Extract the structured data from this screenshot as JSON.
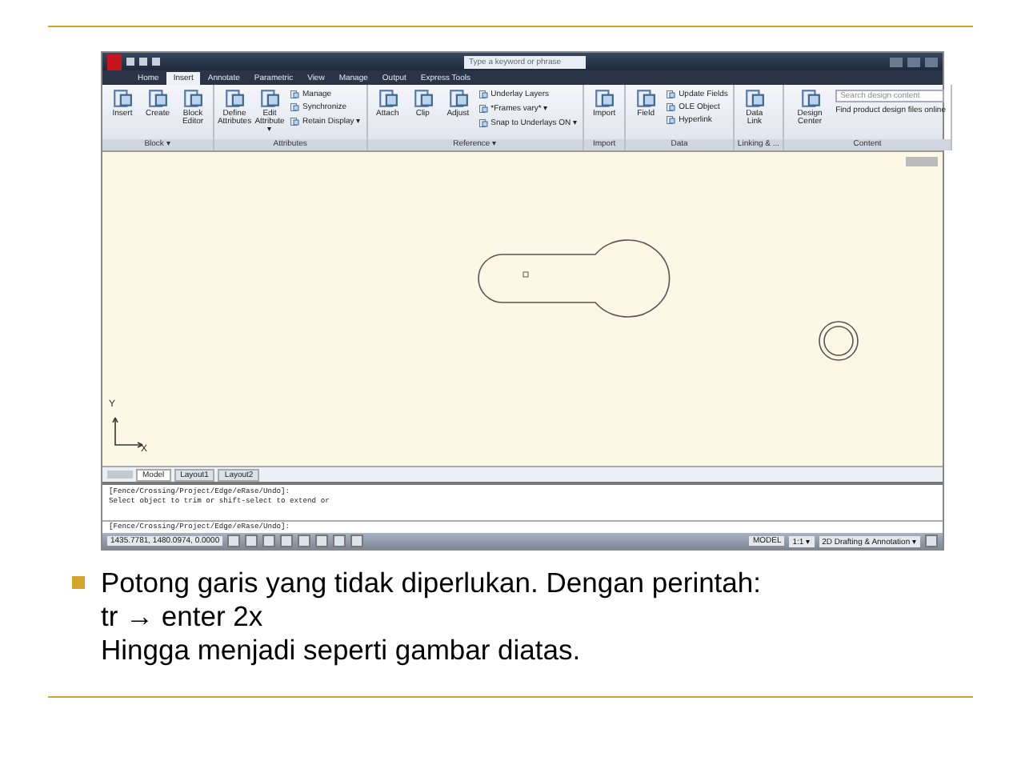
{
  "app": {
    "search_placeholder": "Type a keyword or phrase",
    "tabs": [
      {
        "label": "Home",
        "selected": false
      },
      {
        "label": "Insert",
        "selected": true
      },
      {
        "label": "Annotate",
        "selected": false
      },
      {
        "label": "Parametric",
        "selected": false
      },
      {
        "label": "View",
        "selected": false
      },
      {
        "label": "Manage",
        "selected": false
      },
      {
        "label": "Output",
        "selected": false
      },
      {
        "label": "Express Tools",
        "selected": false
      }
    ],
    "panels": [
      {
        "label": "Block ▾",
        "large": [
          "Insert",
          "Create",
          "Block Editor"
        ]
      },
      {
        "label": "Attributes",
        "large": [
          "Define Attributes",
          "Edit Attribute ▾"
        ],
        "small": [
          "Manage",
          "Synchronize",
          "Retain Display ▾"
        ]
      },
      {
        "label": "Reference ▾",
        "large": [
          "Attach",
          "Clip",
          "Adjust"
        ],
        "small": [
          "Underlay Layers",
          "*Frames vary* ▾",
          "Snap to Underlays ON ▾"
        ]
      },
      {
        "label": "Import",
        "large": [
          "Import"
        ]
      },
      {
        "label": "Data",
        "large": [
          "Field"
        ],
        "small": [
          "Update Fields",
          "OLE Object",
          "Hyperlink"
        ]
      },
      {
        "label": "Linking & ...",
        "large": [
          "Data Link"
        ]
      }
    ],
    "content_panel": {
      "label": "Content",
      "tool": "Design Center",
      "search_placeholder": "Search design content",
      "link": "Find product design files online"
    },
    "axis": {
      "y": "Y",
      "x": "X"
    },
    "layout_tabs": [
      {
        "label": "Model",
        "selected": true
      },
      {
        "label": "Layout1",
        "selected": false
      },
      {
        "label": "Layout2",
        "selected": false
      }
    ],
    "command_history": [
      "[Fence/Crossing/Project/Edge/eRase/Undo]:",
      "Select object to trim or shift-select to extend or"
    ],
    "command_line": "[Fence/Crossing/Project/Edge/eRase/Undo]:",
    "status": {
      "coordinates": "1435.7781, 1480.0974, 0.0000",
      "model": "MODEL",
      "scale": "1:1 ▾",
      "workspace": "2D Drafting & Annotation ▾"
    }
  },
  "bullet": "Potong garis yang tidak diperlukan. Dengan perintah:\ntr → enter 2x\nHingga menjadi seperti gambar diatas."
}
